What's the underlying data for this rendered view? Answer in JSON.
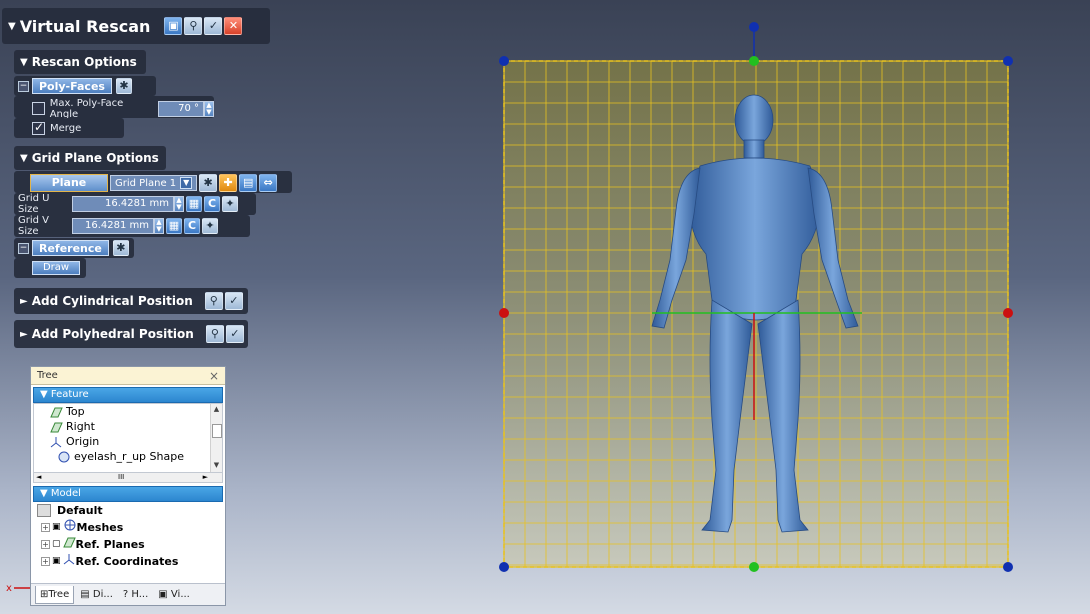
{
  "panel": {
    "title": "Virtual Rescan",
    "rescan_options": {
      "heading": "Rescan Options",
      "poly_faces": "Poly-Faces",
      "max_angle_label": "Max. Poly-Face Angle",
      "max_angle_value": "70 °",
      "max_angle_checked": false,
      "merge_label": "Merge",
      "merge_checked": true
    },
    "grid_plane_options": {
      "heading": "Grid Plane Options",
      "plane_button": "Plane",
      "plane_select": "Grid Plane 1",
      "grid_u_label": "Grid U Size",
      "grid_u_value": "16.4281 mm",
      "grid_v_label": "Grid V Size",
      "grid_v_value": "16.4281 mm",
      "reference": "Reference",
      "draw_button": "Draw"
    },
    "add_cylindrical": "Add Cylindrical Position",
    "add_polyhedral": "Add Polyhedral Position"
  },
  "tree": {
    "title": "Tree",
    "close": "×",
    "feature_heading": "Feature",
    "feature_items": [
      "Top",
      "Right",
      "Origin",
      "eyelash_r_up Shape"
    ],
    "hscroll_glyph": "III",
    "model_heading": "Model",
    "model_default": "Default",
    "model_items": [
      "Meshes",
      "Ref. Planes",
      "Ref. Coordinates"
    ],
    "tabs": [
      "Tree",
      "Di...",
      "H...",
      "Vi..."
    ]
  },
  "colors": {
    "grid_line": "#e8c21f",
    "grid_fill": "#8b8a52",
    "handle_blue": "#1030b0",
    "handle_green": "#22c020",
    "handle_red": "#cc1010",
    "model": "#5f8ac6",
    "tree_section": "#2c86cf"
  },
  "icons": {
    "title_actions": [
      "camera-icon",
      "magnifier-icon",
      "checkmark-icon",
      "close-icon"
    ],
    "plane_actions": [
      "star-icon",
      "add-icon",
      "save-icon",
      "flip-icon"
    ]
  }
}
